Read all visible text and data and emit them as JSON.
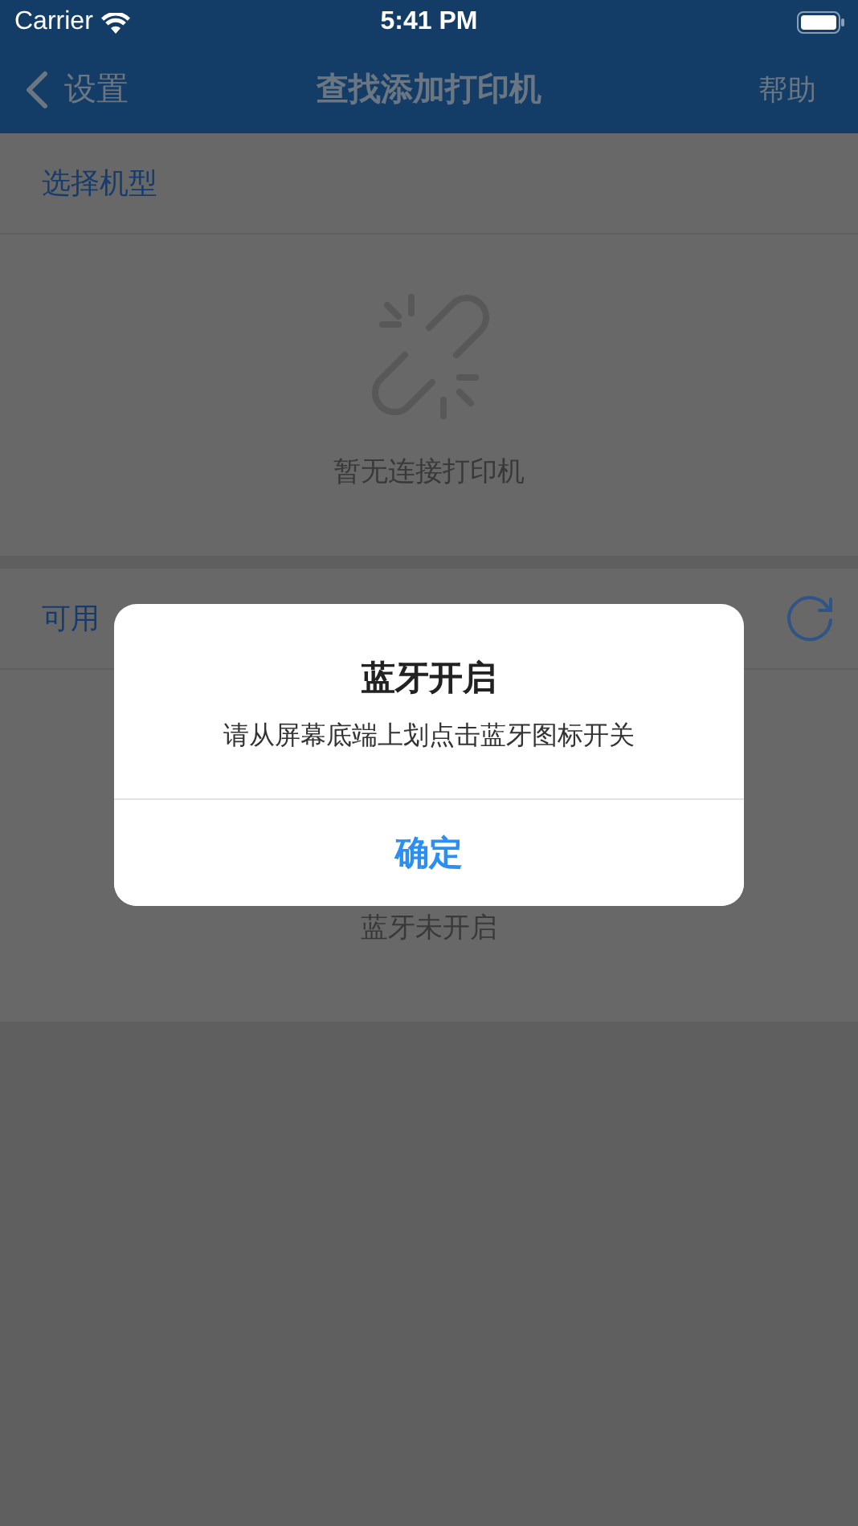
{
  "status_bar": {
    "carrier": "Carrier",
    "time": "5:41 PM"
  },
  "nav_bar": {
    "back_label": "设置",
    "title": "查找添加打印机",
    "action": "帮助"
  },
  "model_section": {
    "label": "选择机型",
    "empty_text": "暂无连接打印机"
  },
  "devices_section": {
    "label": "可用",
    "status_text": "蓝牙未开启"
  },
  "alert": {
    "title": "蓝牙开启",
    "message": "请从屏幕底端上划点击蓝牙图标开关",
    "buttons": [
      "确定"
    ]
  }
}
